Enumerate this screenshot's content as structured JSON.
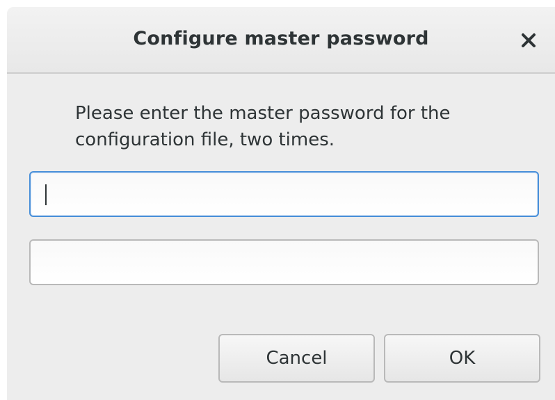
{
  "dialog": {
    "title": "Configure master password",
    "close_icon": "close-icon",
    "message": "Please enter the master password for the configuration file, two times.",
    "fields": [
      {
        "value": "",
        "focused": true
      },
      {
        "value": "",
        "focused": false
      }
    ],
    "buttons": {
      "cancel_label": "Cancel",
      "ok_label": "OK"
    },
    "colors": {
      "focus_border": "#4a90d9",
      "text": "#2e3436",
      "background": "#ededed"
    }
  }
}
